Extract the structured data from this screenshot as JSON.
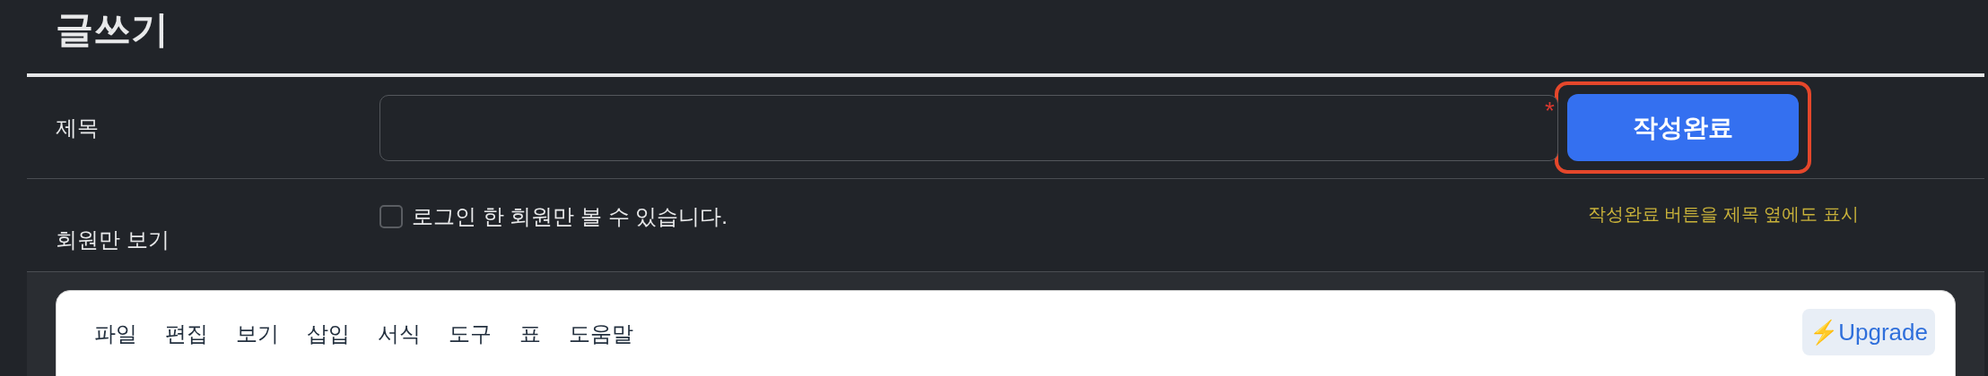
{
  "heading": "글쓰기",
  "title_row": {
    "label": "제목",
    "required_mark": "*",
    "submit_button": {
      "label": "작성완료",
      "highlighted": true
    },
    "annotation": "작성완료 버튼을 제목 옆에도 표시"
  },
  "members_row": {
    "label": "회원만 보기",
    "checkbox": {
      "label": "로그인 한 회원만 볼 수 있습니다.",
      "checked": false
    }
  },
  "editor": {
    "menu": [
      "파일",
      "편집",
      "보기",
      "삽입",
      "서식",
      "도구",
      "표",
      "도움말"
    ],
    "upgrade": {
      "icon": "⚡",
      "label": "Upgrade"
    }
  }
}
